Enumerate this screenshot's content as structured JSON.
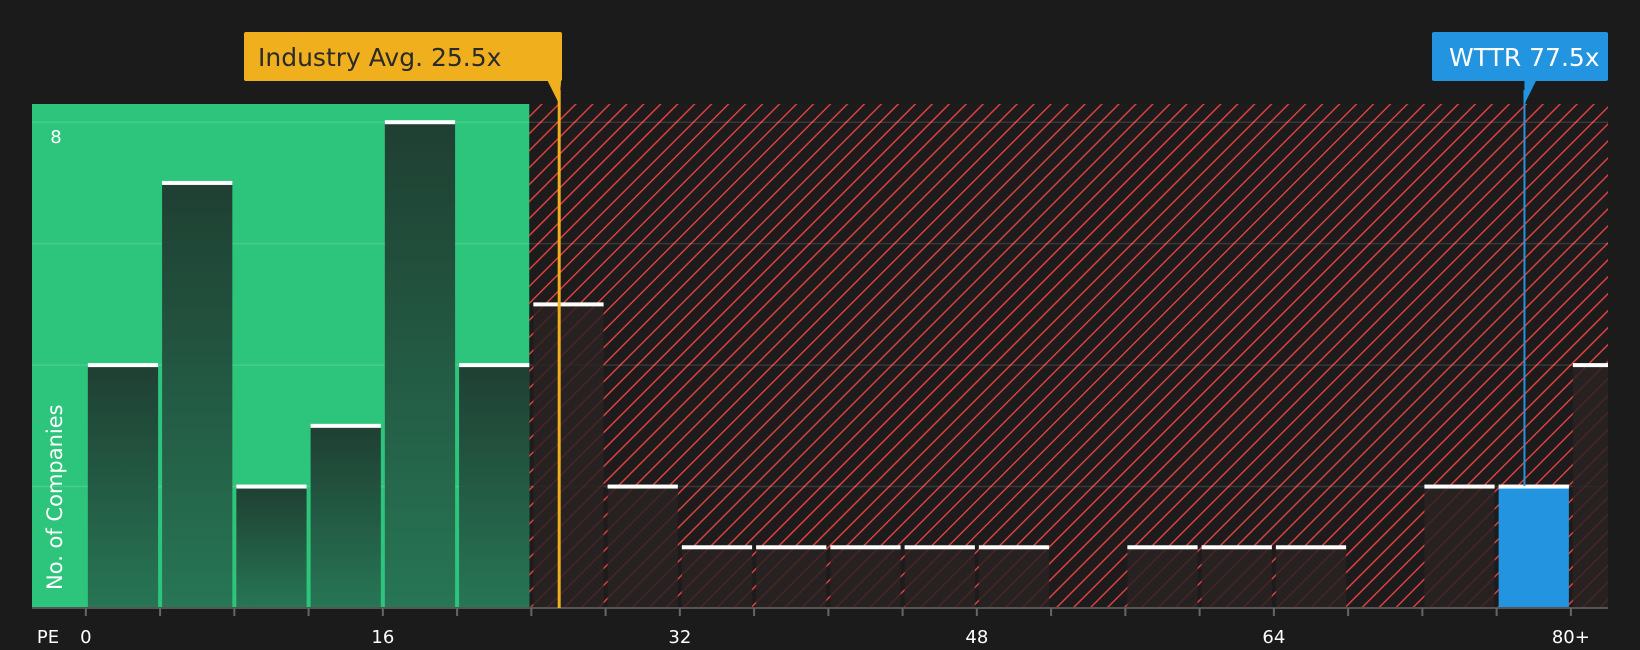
{
  "chart_data": {
    "type": "bar",
    "x_axis_label": "PE",
    "ylabel": "No. of Companies",
    "x_ticks": [
      "0",
      "16",
      "32",
      "48",
      "64",
      "80+"
    ],
    "x_tick_values": [
      0,
      16,
      32,
      48,
      64,
      80
    ],
    "y_tick_labels": [
      "8"
    ],
    "y_tick_values": [
      8
    ],
    "ylim": [
      0,
      8.3
    ],
    "xlim": [
      -2.9,
      82
    ],
    "bin_width": 4,
    "bins": [
      {
        "x_start": 0,
        "count": 4
      },
      {
        "x_start": 4,
        "count": 7
      },
      {
        "x_start": 8,
        "count": 2
      },
      {
        "x_start": 12,
        "count": 3
      },
      {
        "x_start": 16,
        "count": 8
      },
      {
        "x_start": 20,
        "count": 4
      },
      {
        "x_start": 24,
        "count": 5
      },
      {
        "x_start": 28,
        "count": 2
      },
      {
        "x_start": 32,
        "count": 1
      },
      {
        "x_start": 36,
        "count": 1
      },
      {
        "x_start": 40,
        "count": 1
      },
      {
        "x_start": 44,
        "count": 1
      },
      {
        "x_start": 48,
        "count": 1
      },
      {
        "x_start": 52,
        "count": 0
      },
      {
        "x_start": 56,
        "count": 1
      },
      {
        "x_start": 60,
        "count": 1
      },
      {
        "x_start": 64,
        "count": 1
      },
      {
        "x_start": 68,
        "count": 0
      },
      {
        "x_start": 72,
        "count": 2
      },
      {
        "x_start": 76,
        "count": 2,
        "highlight": true
      },
      {
        "x_start": 80,
        "count": 4
      }
    ],
    "industry_avg": {
      "value": 25.5,
      "label": "Industry Avg. 25.5x"
    },
    "company": {
      "value": 77.5,
      "label": "WTTR 77.5x"
    },
    "grid": true,
    "colors": {
      "background": "#1b1b1b",
      "good_zone": "#2dc57c",
      "bad_zone_hatch": "#d9413f",
      "bar_green_top": "#1f3f32",
      "bar_green_bottom": "#277655",
      "bar_dark": "#2a2222",
      "highlight_bar": "#2394e0",
      "avg_line": "#f0b01e",
      "company_line": "#2394e0",
      "bar_cap": "#ffffff",
      "text": "#ffffff",
      "avg_text": "#2a2a2a"
    }
  }
}
